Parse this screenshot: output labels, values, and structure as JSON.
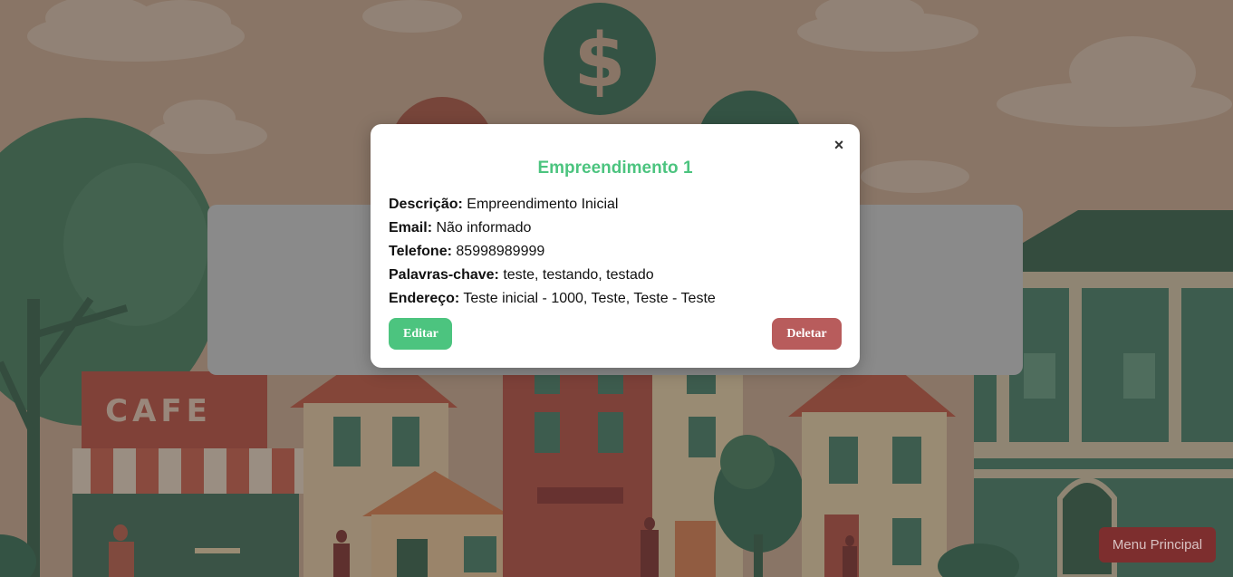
{
  "background": {
    "sign_text": "CAFE",
    "coin_symbol": "$"
  },
  "modal": {
    "title": "Empreendimento 1",
    "close_symbol": "×",
    "fields": [
      {
        "label": "Descrição:",
        "value": "Empreendimento Inicial"
      },
      {
        "label": "Email:",
        "value": "Não informado"
      },
      {
        "label": "Telefone:",
        "value": "85998989999"
      },
      {
        "label": "Palavras-chave:",
        "value": "teste, testando, testado"
      },
      {
        "label": "Endereço:",
        "value": "Teste inicial - 1000, Teste, Teste - Teste"
      }
    ],
    "edit_label": "Editar",
    "delete_label": "Deletar"
  },
  "menu_button_label": "Menu Principal",
  "colors": {
    "accent_green": "#4cc47f",
    "delete_red": "#b85c5c",
    "menu_button_bg": "#7d2e2e"
  }
}
